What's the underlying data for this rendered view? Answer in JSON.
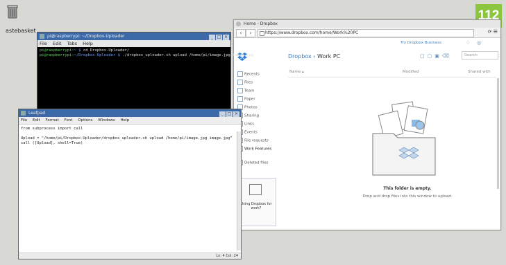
{
  "desktop": {
    "trash_label": "astebasket",
    "badge": "112"
  },
  "browser": {
    "tab_title": "Home - Dropbox",
    "url": "https://www.dropbox.com/home/Work%20PC",
    "upgrade": "Try Dropbox Business",
    "breadcrumb_root": "Dropbox",
    "breadcrumb_sep": "›",
    "breadcrumb_current": "Work PC",
    "search_placeholder": "Search",
    "columns": [
      "Name ▴",
      "Modified",
      "Shared with"
    ],
    "sidebar": [
      "Recents",
      "Files",
      "Team",
      "Paper",
      "Photos",
      "Sharing",
      "Links",
      "Events",
      "File requests",
      "Work Features",
      "Deleted files"
    ],
    "promo_text": "Using Dropbox for work?",
    "empty_title": "This folder is empty.",
    "empty_sub": "Drop and drop files into this window to upload."
  },
  "terminal": {
    "title": "pi@raspberrypi: ~/Dropbox-Uploader",
    "menu": [
      "File",
      "Edit",
      "Tabs",
      "Help"
    ],
    "lines": [
      {
        "prompt": "pi@raspberrypi:",
        "path": "~ $",
        "cmd": " cd Dropbox-Uploader/"
      },
      {
        "prompt": "pi@raspberrypi:",
        "path": "~/Dropbox-Uploader $",
        "cmd": " ./dropbox_uploader.sh upload /home/pi/image.jpg image.jpg"
      }
    ]
  },
  "leafpad": {
    "title": "Leafpad",
    "menu": [
      "File",
      "Edit",
      "Format",
      "Font",
      "Options",
      "Windows",
      "Help"
    ],
    "code": [
      "from subprocess import call",
      "",
      "Upload = \"/home/pi/Dropbox-Uploader/dropbox_uploader.sh upload /home/pi/image.jpg image.jpg\"",
      "call ([Upload], shell=True)"
    ],
    "status": "Ln: 4 Col: 24"
  },
  "colors": {
    "titlebar": "#3c6aa8",
    "badge": "#8cc63f",
    "dropbox_blue": "#3d78b8"
  }
}
